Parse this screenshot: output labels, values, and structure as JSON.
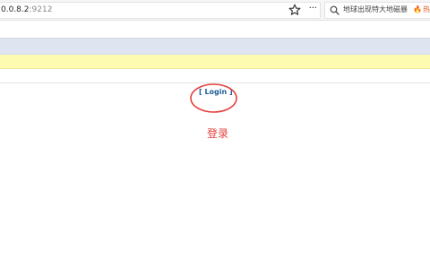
{
  "browser": {
    "url": {
      "host": "0.0.8.2",
      "port": ":9212"
    },
    "page_actions_label": "···",
    "search": {
      "text": "地球出现特大地磁暴",
      "hot_label": "热点"
    },
    "icons": {
      "bookmark": "star-icon",
      "search": "magnifier-icon",
      "hot": "flame-icon"
    }
  },
  "page": {
    "login_link": "[ Login ]",
    "annotation_text": "登录"
  },
  "colors": {
    "nav_band": "#dee5f1",
    "notice_band": "#fdfbb0",
    "login_link": "#215d9a",
    "annotation": "#e5413f",
    "hot_badge": "#e4572e"
  }
}
